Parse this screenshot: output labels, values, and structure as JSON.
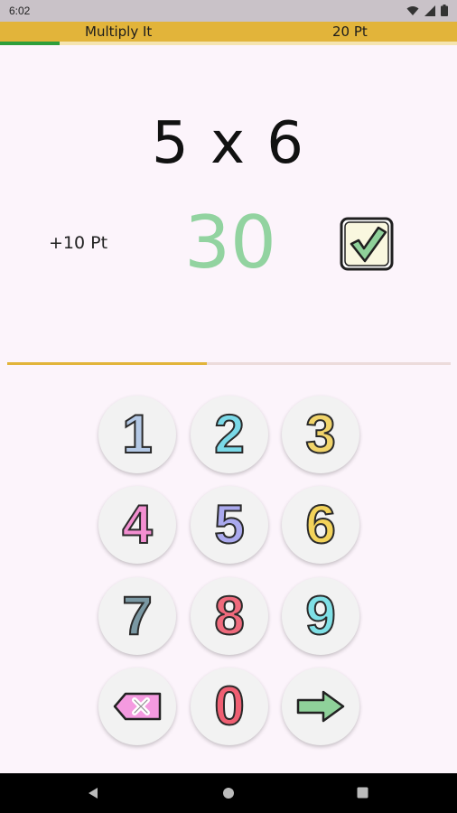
{
  "status_bar": {
    "time": "6:02"
  },
  "app_bar": {
    "title": "Multiply It",
    "score": "20 Pt",
    "level_progress": 0.13
  },
  "question": {
    "text": "5 x 6"
  },
  "result": {
    "points_earned": "+10 Pt",
    "answer": "30",
    "correct": true,
    "answer_color": "#92d3a0"
  },
  "timer": {
    "remaining_fraction": 0.45
  },
  "keypad": {
    "keys": [
      {
        "label": "1",
        "color": "#b4c9e6"
      },
      {
        "label": "2",
        "color": "#7ad9e8"
      },
      {
        "label": "3",
        "color": "#f1d46a"
      },
      {
        "label": "4",
        "color": "#f38fd1"
      },
      {
        "label": "5",
        "color": "#aaa9ee"
      },
      {
        "label": "6",
        "color": "#f3d35a"
      },
      {
        "label": "7",
        "color": "#7a98a3"
      },
      {
        "label": "8",
        "color": "#ef6a7c"
      },
      {
        "label": "9",
        "color": "#7fe0e6"
      },
      {
        "label": "0",
        "color": "#ef5f72"
      }
    ],
    "delete_icon": "backspace-x-icon",
    "submit_icon": "arrow-right-icon"
  },
  "colors": {
    "accent": "#e2b43a",
    "progress_green": "#2e9e3b",
    "background": "#fcf4fb"
  }
}
